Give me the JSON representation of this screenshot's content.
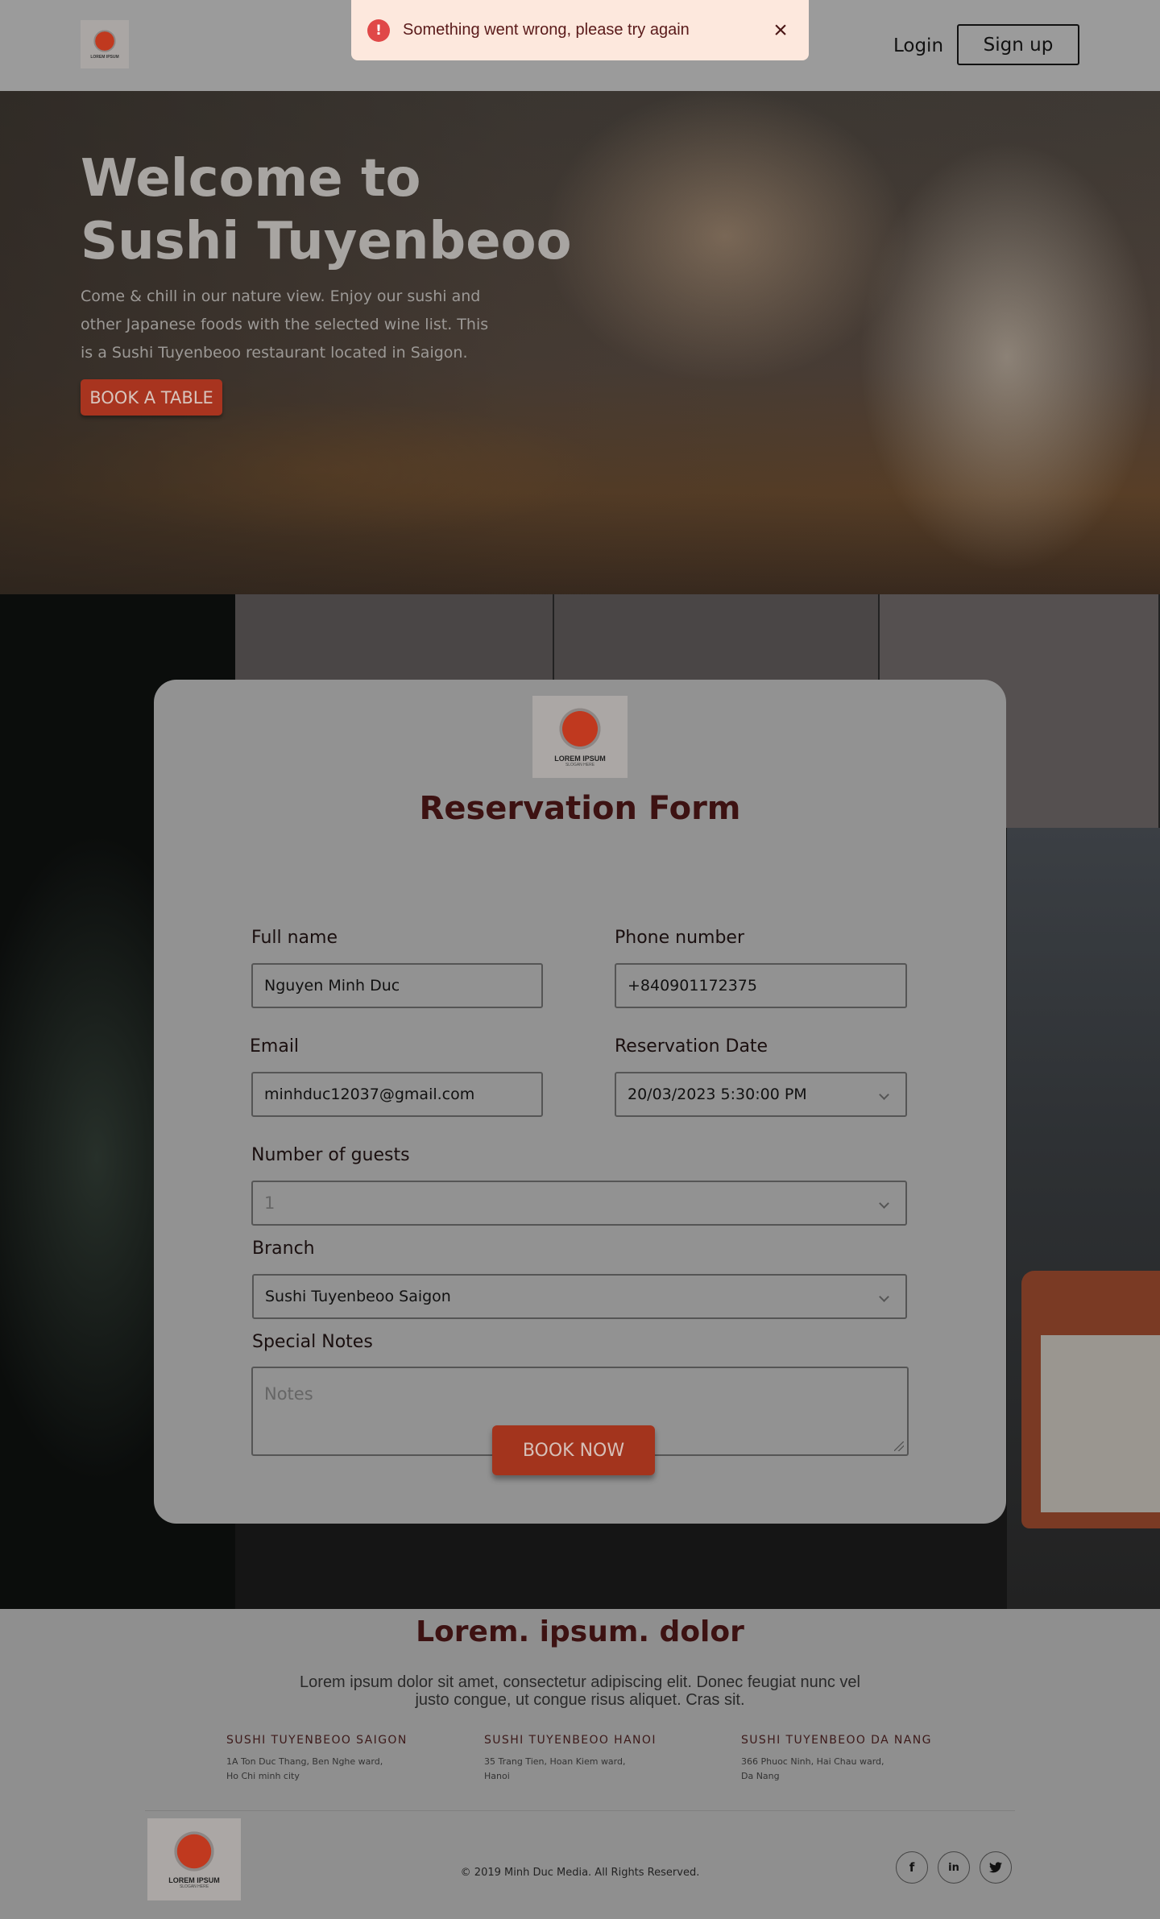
{
  "header": {
    "logo_text": "LOREM IPSUM",
    "login_label": "Login",
    "signup_label": "Sign up"
  },
  "toast": {
    "message": "Something went wrong, please try again",
    "icon": "error-icon",
    "close_icon": "close-icon",
    "icon_color": "#e04848",
    "background": "#fde8dd"
  },
  "hero": {
    "title_line1": "Welcome to",
    "title_line2": "Sushi Tuyenbeoo",
    "description": "Come & chill in our nature view. Enjoy our sushi and other Japanese foods with the selected wine list. This is a Sushi Tuyenbeoo restaurant located in Saigon.",
    "cta_label": "BOOK A TABLE"
  },
  "form": {
    "logo_text": "LOREM IPSUM",
    "logo_sub": "SLOGAN HERE",
    "title": "Reservation Form",
    "full_name": {
      "label": "Full name",
      "value": "Nguyen Minh Duc"
    },
    "phone": {
      "label": "Phone number",
      "value": "+840901172375"
    },
    "email": {
      "label": "Email",
      "value": "minhduc12037@gmail.com"
    },
    "date": {
      "label": "Reservation Date",
      "value": "20/03/2023 5:30:00 PM"
    },
    "guests": {
      "label": "Number of guests",
      "value": "1"
    },
    "branch": {
      "label": "Branch",
      "value": "Sushi Tuyenbeoo Saigon"
    },
    "notes": {
      "label": "Special Notes",
      "placeholder": "Notes"
    },
    "submit_label": "BOOK NOW"
  },
  "footer": {
    "title": "Lorem. ipsum. dolor",
    "description": "Lorem ipsum dolor sit amet, consectetur adipiscing elit. Donec feugiat nunc vel justo congue, ut congue risus aliquet. Cras sit.",
    "branches": [
      {
        "name": "SUSHI TUYENBEOO SAIGON",
        "address": "1A Ton Duc Thang, Ben Nghe ward,\nHo Chi minh city"
      },
      {
        "name": "SUSHI TUYENBEOO HANOI",
        "address": "35 Trang Tien, Hoan Kiem ward,\nHanoi"
      },
      {
        "name": "SUSHI TUYENBEOO DA NANG",
        "address": "366 Phuoc Ninh, Hai Chau ward,\nDa Nang"
      }
    ],
    "logo_text": "LOREM IPSUM",
    "logo_sub": "SLOGAN HERE",
    "copyright": "© 2019 Minh Duc Media. All Rights Reserved.",
    "social": [
      {
        "icon": "facebook-icon",
        "glyph": "f"
      },
      {
        "icon": "linkedin-icon",
        "glyph": "in"
      },
      {
        "icon": "twitter-icon",
        "glyph": "🐦"
      }
    ]
  },
  "colors": {
    "brand_red": "#a3341d",
    "heading_dark": "#3d1212"
  }
}
